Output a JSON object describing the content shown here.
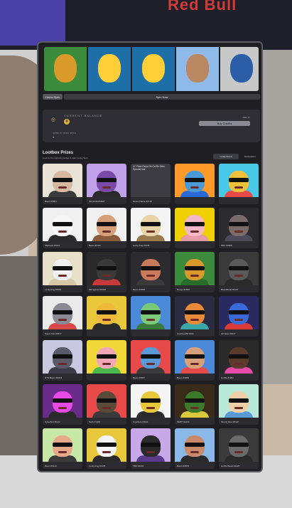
{
  "background": {
    "brand_text": "Red Bull"
  },
  "banner": {
    "tiles": [
      {
        "bg": "#3c8a3c",
        "fg": "#d89a2a"
      },
      {
        "bg": "#1e6fa8",
        "fg": "#ffcf3a"
      },
      {
        "bg": "#1e6fa8",
        "fg": "#ffcf3a"
      },
      {
        "bg": "#8fb9e8",
        "fg": "#b98762"
      },
      {
        "bg": "#c8c8c8",
        "fg": "#2c5ea8"
      }
    ]
  },
  "tabs": {
    "left": "Demo Spin",
    "right": "Spin Now"
  },
  "balance": {
    "label": "CURRENT BALANCE",
    "value": "0",
    "sub_label": "SPINS TO OPEN SPINS",
    "sub_value": "1",
    "price": "FEE  1K",
    "buy_label": "Buy Credits"
  },
  "prizes": {
    "title": "Lootbox Prizes",
    "subtitle": "Look for the lightning badge to open Lucky Spin.",
    "leaderboard_label": "Leaderboard",
    "marketplace_label": "Marketplace"
  },
  "cards": [
    {
      "label": "Beers #0801",
      "bg": "#e8e3d6",
      "skin": "#d8b8a0",
      "body": "#3a3a3a"
    },
    {
      "label": "SlimeGlow#0827",
      "bg": "#c0a0e8",
      "skin": "#7a4aa8",
      "body": "#2a2a2a"
    },
    {
      "label": "Nouns Name #1738",
      "bg": "#3c3c42",
      "skin": "#3c3c42",
      "body": "#3c3c42",
      "note": "47 Prize Reps Cb Ca Rn Dbrc Special lost"
    },
    {
      "label": "",
      "bg": "#ff9a2a",
      "skin": "#4a9ad8",
      "body": "#2a6ad8"
    },
    {
      "label": "",
      "bg": "#4ac8e8",
      "skin": "#f0c03a",
      "body": "#e84a4a"
    },
    {
      "label": "MadLads #4411",
      "bg": "#f0f0f0",
      "skin": "#f6f6f6",
      "body": "#2a2a2a"
    },
    {
      "label": "Beers #4411",
      "bg": "#f0f0f0",
      "skin": "#d6a07a",
      "body": "#8a5a3a"
    },
    {
      "label": "Lucky Dog #2345",
      "bg": "#f4f4f4",
      "skin": "#e8d4a8",
      "body": "#9a7a4a"
    },
    {
      "label": "",
      "bg": "#f0d000",
      "skin": "#f3b8c8",
      "body": "#e89aa8"
    },
    {
      "label": "DBC #0388",
      "bg": "#2a2a30",
      "skin": "#7a6a6a",
      "body": "#4a4a5a"
    },
    {
      "label": "Lucky Dog #5054",
      "bg": "#e8e0c8",
      "skin": "#f0f0f0",
      "body": "#d8c8a8"
    },
    {
      "label": "Slimeghoul #0048",
      "bg": "#2a2a2a",
      "skin": "#3a3a3a",
      "body": "#c83a3a"
    },
    {
      "label": "Beers #4698",
      "bg": "#2b2b30",
      "skin": "#c87a5a",
      "body": "#3a3a3a"
    },
    {
      "label": "Pengu #2698",
      "bg": "#3c8a3c",
      "skin": "#d89a2a",
      "body": "#2a6a2a"
    },
    {
      "label": "BeastMode #2197",
      "bg": "#3a3a3a",
      "skin": "#5a5a5a",
      "body": "#2a2a2a"
    },
    {
      "label": "Super Dub #0577",
      "bg": "#eaeaea",
      "skin": "#8a8a96",
      "body": "#d84a4a"
    },
    {
      "label": "",
      "bg": "#e8c83a",
      "skin": "#f0b83a",
      "body": "#2a2a2a"
    },
    {
      "label": "",
      "bg": "#4a8ad8",
      "skin": "#7ac87a",
      "body": "#3a7a3a"
    },
    {
      "label": "CrestlessBP #011",
      "bg": "#2a2a40",
      "skin": "#e88a3a",
      "body": "#3aa8a8"
    },
    {
      "label": "LP Neko #0017",
      "bg": "#2a2a60",
      "skin": "#3a6ad8",
      "body": "#d83a3a"
    },
    {
      "label": "DTN Bears #0003",
      "bg": "#c8c8e0",
      "skin": "#5a5a6a",
      "body": "#3a3a4a"
    },
    {
      "label": "",
      "bg": "#f0d83a",
      "skin": "#f3a8b8",
      "body": "#4ab84a"
    },
    {
      "label": "Beers #3987",
      "bg": "#e84a4a",
      "skin": "#5a9ad8",
      "body": "#3a3a3a"
    },
    {
      "label": "Beers #4882",
      "bg": "#4a8ad8",
      "skin": "#d8a07a",
      "body": "#e84a4a"
    },
    {
      "label": "Gorilla #1902",
      "bg": "#2a2a2a",
      "skin": "#5a3a2a",
      "body": "#e84aa8"
    },
    {
      "label": "Cyberbull #0214",
      "bg": "#6a2a8a",
      "skin": "#e84ae8",
      "body": "#2a2a2a"
    },
    {
      "label": "Sloth #1468",
      "bg": "#e84a4a",
      "skin": "#5a4a3a",
      "body": "#3a3a3a"
    },
    {
      "label": "Smolbots #3011",
      "bg": "#f4f4f4",
      "skin": "#e8c83a",
      "body": "#2a2a2a"
    },
    {
      "label": "SMBT #1403",
      "bg": "#3a2a1a",
      "skin": "#3a7a2a",
      "body": "#d8c83a"
    },
    {
      "label": "Moody Dino #0118",
      "bg": "#b8e8d8",
      "skin": "#f0d0a8",
      "body": "#5a9ad8"
    },
    {
      "label": "Beers #4113",
      "bg": "#c8e8a8",
      "skin": "#e8a88a",
      "body": "#3a3a3a"
    },
    {
      "label": "Lucky Dog #2195",
      "bg": "#e8c83a",
      "skin": "#f4f4f4",
      "body": "#2a2a2a"
    },
    {
      "label": "TBD #1169",
      "bg": "#c8a8e8",
      "skin": "#2a2a2a",
      "body": "#5a3a8a"
    },
    {
      "label": "Beers #4553",
      "bg": "#8ab8e8",
      "skin": "#c88a6a",
      "body": "#2a2a2a"
    },
    {
      "label": "Gorilla Beast #1025",
      "bg": "#3a3a3a",
      "skin": "#6a6a6a",
      "body": "#2a2a2a"
    }
  ]
}
